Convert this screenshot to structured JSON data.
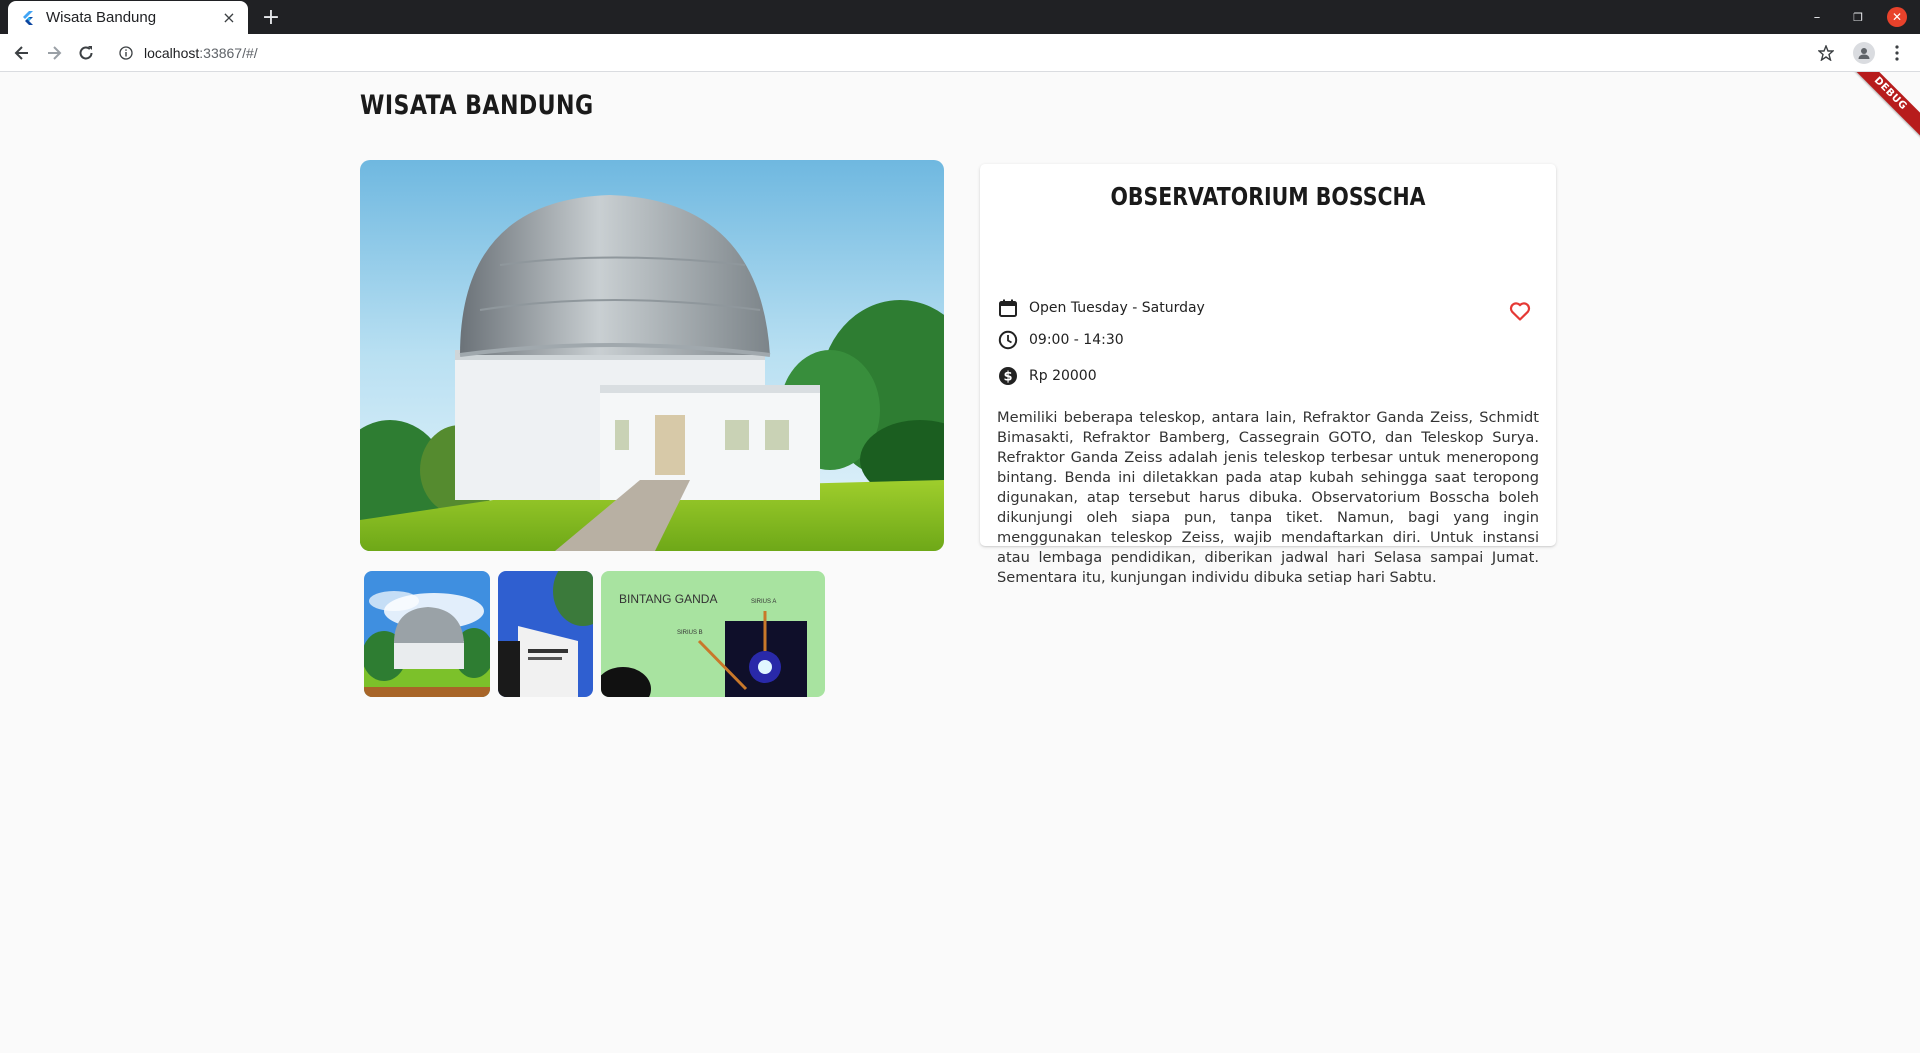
{
  "browser": {
    "tab_title": "Wisata Bandung",
    "new_tab_label": "+",
    "close_tab_label": "×",
    "url_host": "localhost",
    "url_rest": ":33867/#/",
    "window_controls": {
      "minimize": "–",
      "maximize": "❐",
      "close": "✕"
    }
  },
  "app": {
    "title": "WISATA BANDUNG",
    "debug_banner": "DEBUG"
  },
  "place": {
    "name": "OBSERVATORIUM BOSSCHA",
    "open_days": "Open Tuesday - Saturday",
    "open_hours": "09:00 - 14:30",
    "ticket_price": "Rp 20000",
    "description": "Memiliki beberapa teleskop, antara lain, Refraktor Ganda Zeiss, Schmidt Bimasakti, Refraktor Bamberg, Cassegrain GOTO, dan Teleskop Surya. Refraktor Ganda Zeiss adalah jenis teleskop terbesar untuk meneropong bintang. Benda ini diletakkan pada atap kubah sehingga saat teropong digunakan, atap tersebut harus dibuka. Observatorium Bosscha boleh dikunjungi oleh siapa pun, tanpa tiket. Namun, bagi yang ingin menggunakan teleskop Zeiss, wajib mendaftarkan diri. Untuk instansi atau lembaga pendidikan, diberikan jadwal hari Selasa sampai Jumat. Sementara itu, kunjungan individu dibuka setiap hari Sabtu.",
    "gallery_text": {
      "panel_title": "BINTANG GANDA",
      "label_a": "SIRIUS A",
      "label_b": "SIRIUS B"
    }
  },
  "icons": {
    "calendar": "calendar-icon",
    "clock": "clock-icon",
    "money": "dollar-icon",
    "favorite": "heart-outline-icon"
  },
  "colors": {
    "favorite": "#e53935",
    "background": "#fafafa",
    "debug": "#b71c1c"
  }
}
